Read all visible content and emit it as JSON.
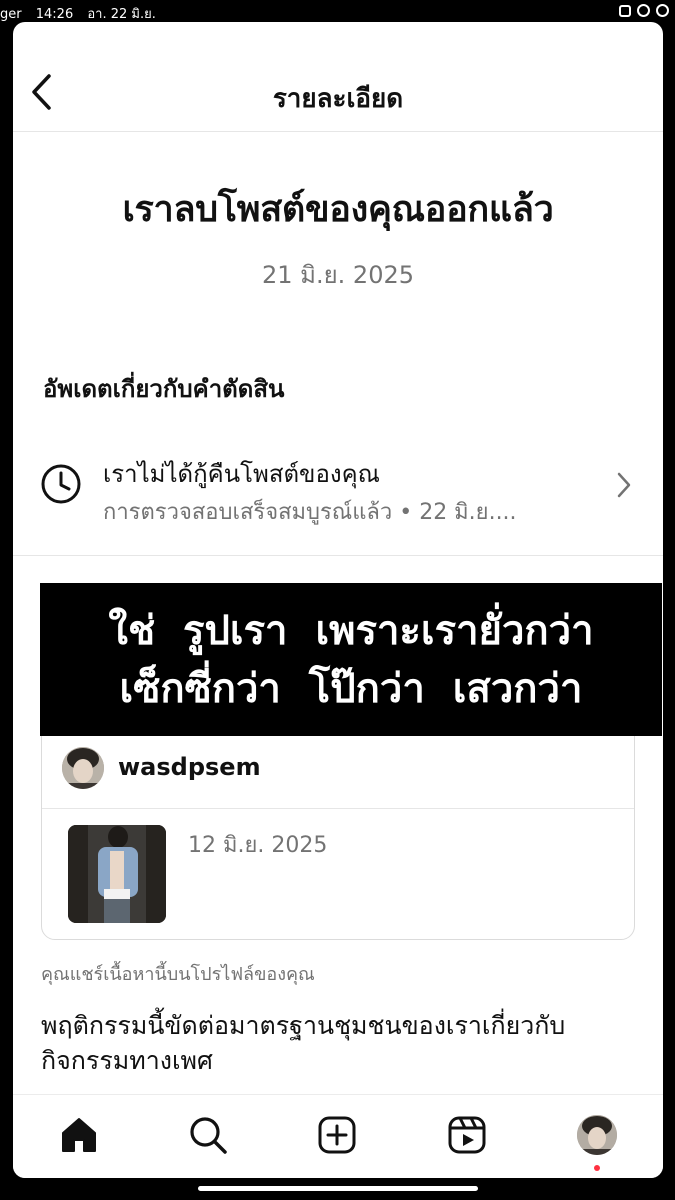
{
  "status_bar": {
    "app": "ger",
    "time": "14:26",
    "date": "อา. 22 มิ.ย."
  },
  "header": {
    "title": "รายละเอียด"
  },
  "notice": {
    "headline": "เราลบโพสต์ของคุณออกแล้ว",
    "date": "21 มิ.ย. 2025"
  },
  "decision": {
    "section_title": "อัพเดตเกี่ยวกับคำตัดสิน",
    "title": "เราไม่ได้กู้คืนโพสต์ของคุณ",
    "subtitle": "การตรวจสอบเสร็จสมบูรณ์แล้ว • 22 มิ.ย...."
  },
  "caption_overlay": {
    "line1": "ใช่ รูปเรา เพราะเรายั่วกว่า",
    "line2": "เซ็กซี่กว่า โป๊กว่า เสวกว่า"
  },
  "post": {
    "username": "wasdpsem",
    "date": "12 มิ.ย. 2025"
  },
  "shared_note": "คุณแชร์เนื้อหานี้บนโปรไฟล์ของคุณ",
  "violation_text": "พฤติกรรมนี้ขัดต่อมาตรฐานชุมชนของเราเกี่ยวกับกิจกรรมทางเพศ",
  "colors": {
    "secondary_text": "#737373",
    "notification_dot": "#ff3040",
    "divider": "#e6e6e6"
  },
  "icons": {
    "back": "chevron-left-icon",
    "clock": "clock-icon",
    "forward": "chevron-right-icon",
    "nav": [
      "home-icon",
      "search-icon",
      "create-icon",
      "reels-icon",
      "profile-avatar"
    ]
  }
}
